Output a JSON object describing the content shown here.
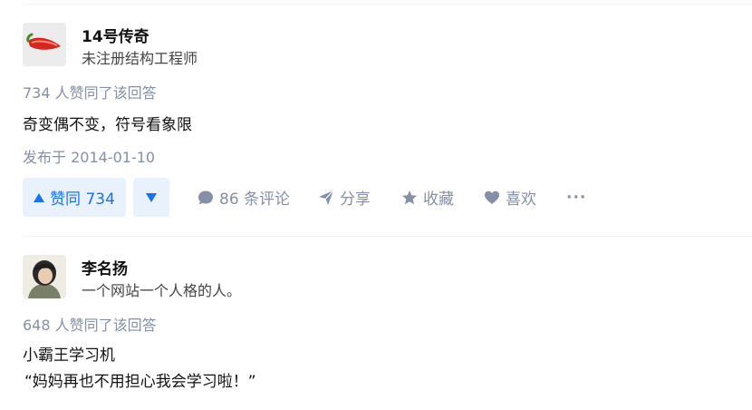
{
  "answers": [
    {
      "author_name": "14号传奇",
      "author_headline": "未注册结构工程师",
      "vote_summary": "734 人赞同了该回答",
      "content": [
        "奇变偶不变，符号看象限"
      ],
      "publish_time": "发布于 2014-01-10",
      "actions": {
        "upvote_label": "赞同 734",
        "comments_label": "86 条评论",
        "share_label": "分享",
        "favorite_label": "收藏",
        "like_label": "喜欢",
        "more_label": "···"
      }
    },
    {
      "author_name": "李名扬",
      "author_headline": "一个网站一个人格的人。",
      "vote_summary": "648 人赞同了该回答",
      "content": [
        "小霸王学习机",
        "“妈妈再也不用担心我会学习啦！”"
      ]
    }
  ],
  "icons": {
    "avatar_1": "chili-pepper-avatar",
    "avatar_2": "person-photo-avatar",
    "upvote": "triangle-up-icon",
    "downvote": "triangle-down-icon",
    "comment": "comment-bubble-icon",
    "share": "paper-plane-icon",
    "favorite": "star-icon",
    "like": "heart-icon"
  },
  "colors": {
    "accent": "#1772f6",
    "accent_bg": "#e8f1fc",
    "meta_text": "#8590a6",
    "divider": "#f0f2f5"
  }
}
